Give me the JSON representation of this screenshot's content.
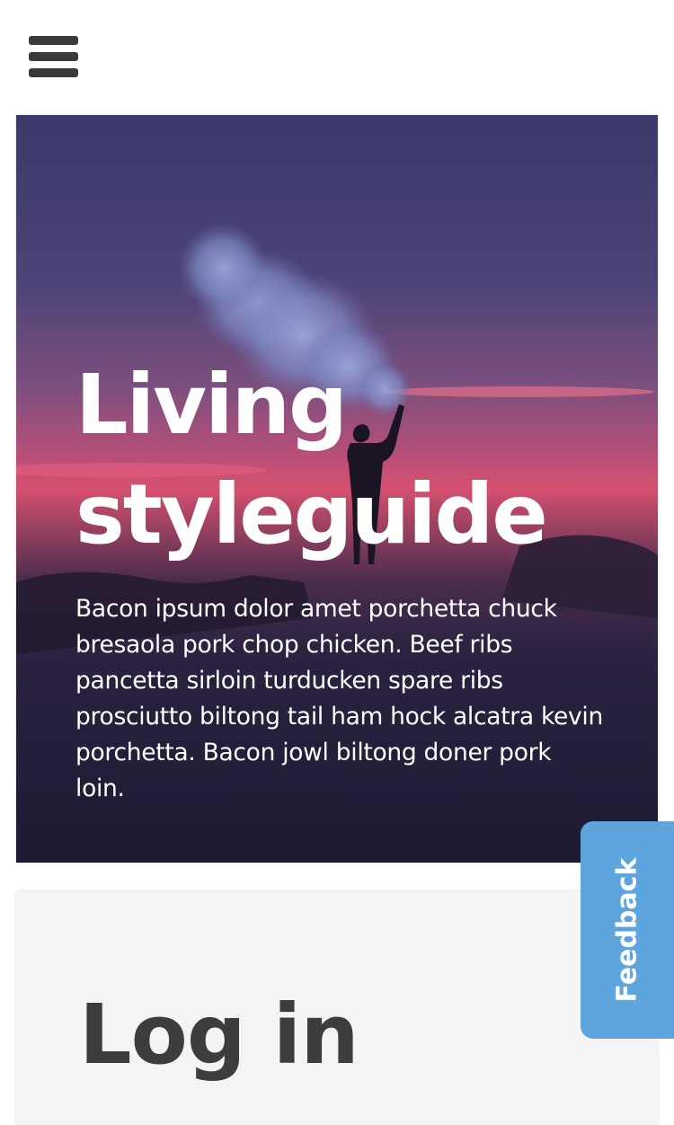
{
  "header": {
    "menu_icon": "hamburger-menu-icon"
  },
  "hero": {
    "title": "Living styleguide",
    "body": "Bacon ipsum dolor amet porchetta chuck bresaola pork chop chicken. Beef ribs pancetta sirloin turducken spare ribs prosciutto biltong tail ham hock alcatra kevin porchetta. Bacon jowl biltong doner pork loin.",
    "background_image": "silhouette of person holding smoke flare at sunset beach"
  },
  "login": {
    "title": "Log in"
  },
  "feedback": {
    "label": "Feedback",
    "color": "#5ea5de"
  },
  "colors": {
    "hero_overlay_top": "#3b3a68",
    "hero_overlay_bottom": "#1e1a33",
    "sunset_accent": "#e04a6a",
    "login_card_bg": "#f4f4f4",
    "text_dark": "#3d3d3d"
  }
}
